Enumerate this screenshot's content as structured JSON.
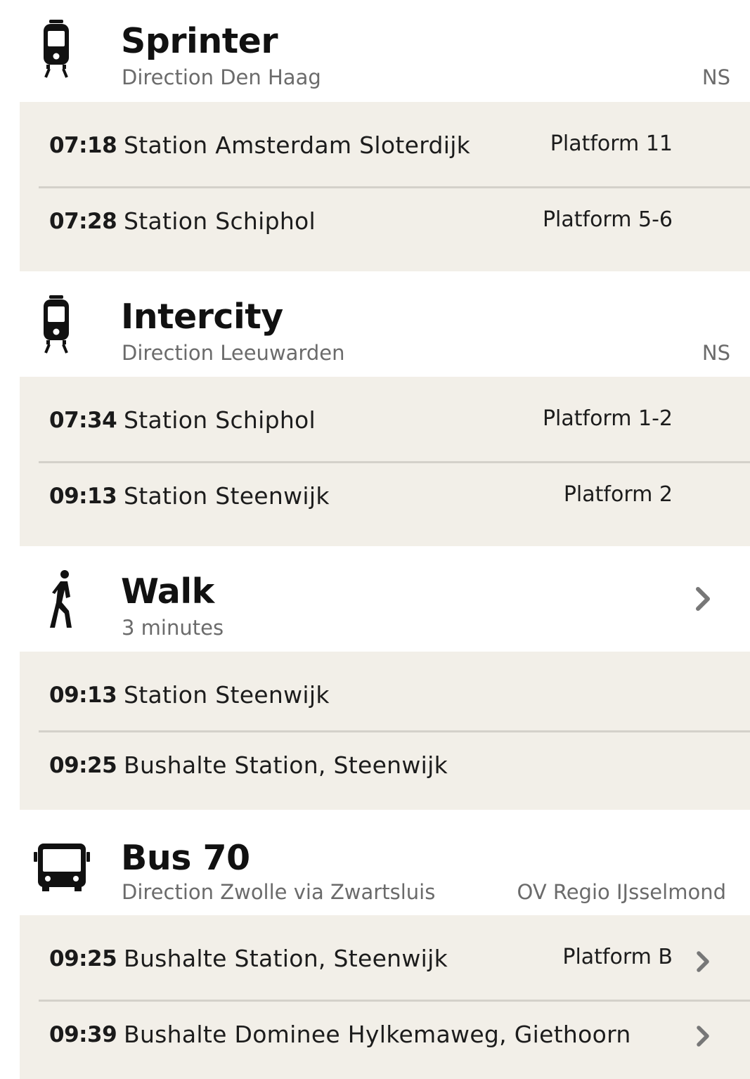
{
  "legs": [
    {
      "icon": "train-icon",
      "title": "Sprinter",
      "subtitle": "Direction Den Haag",
      "operator": "NS",
      "stops": [
        {
          "time": "07:18",
          "name": "Station Amsterdam Sloterdijk",
          "platform": "Platform 11"
        },
        {
          "time": "07:28",
          "name": "Station Schiphol",
          "platform": "Platform 5-6"
        }
      ]
    },
    {
      "icon": "train-icon",
      "title": "Intercity",
      "subtitle": "Direction Leeuwarden",
      "operator": "NS",
      "stops": [
        {
          "time": "07:34",
          "name": "Station Schiphol",
          "platform": "Platform 1-2"
        },
        {
          "time": "09:13",
          "name": "Station Steenwijk",
          "platform": "Platform 2"
        }
      ]
    },
    {
      "icon": "walk-icon",
      "title": "Walk",
      "subtitle": "3 minutes",
      "stops": [
        {
          "time": "09:13",
          "name": "Station Steenwijk"
        },
        {
          "time": "09:25",
          "name": "Bushalte Station, Steenwijk"
        }
      ]
    },
    {
      "icon": "bus-icon",
      "title": "Bus 70",
      "subtitle": "Direction Zwolle via Zwartsluis",
      "operator": "OV Regio IJsselmond",
      "stops": [
        {
          "time": "09:25",
          "name": "Bushalte Station, Steenwijk",
          "platform": "Platform B"
        },
        {
          "time": "09:39",
          "name": "Bushalte Dominee Hylkemaweg, Giethoorn"
        }
      ]
    }
  ]
}
